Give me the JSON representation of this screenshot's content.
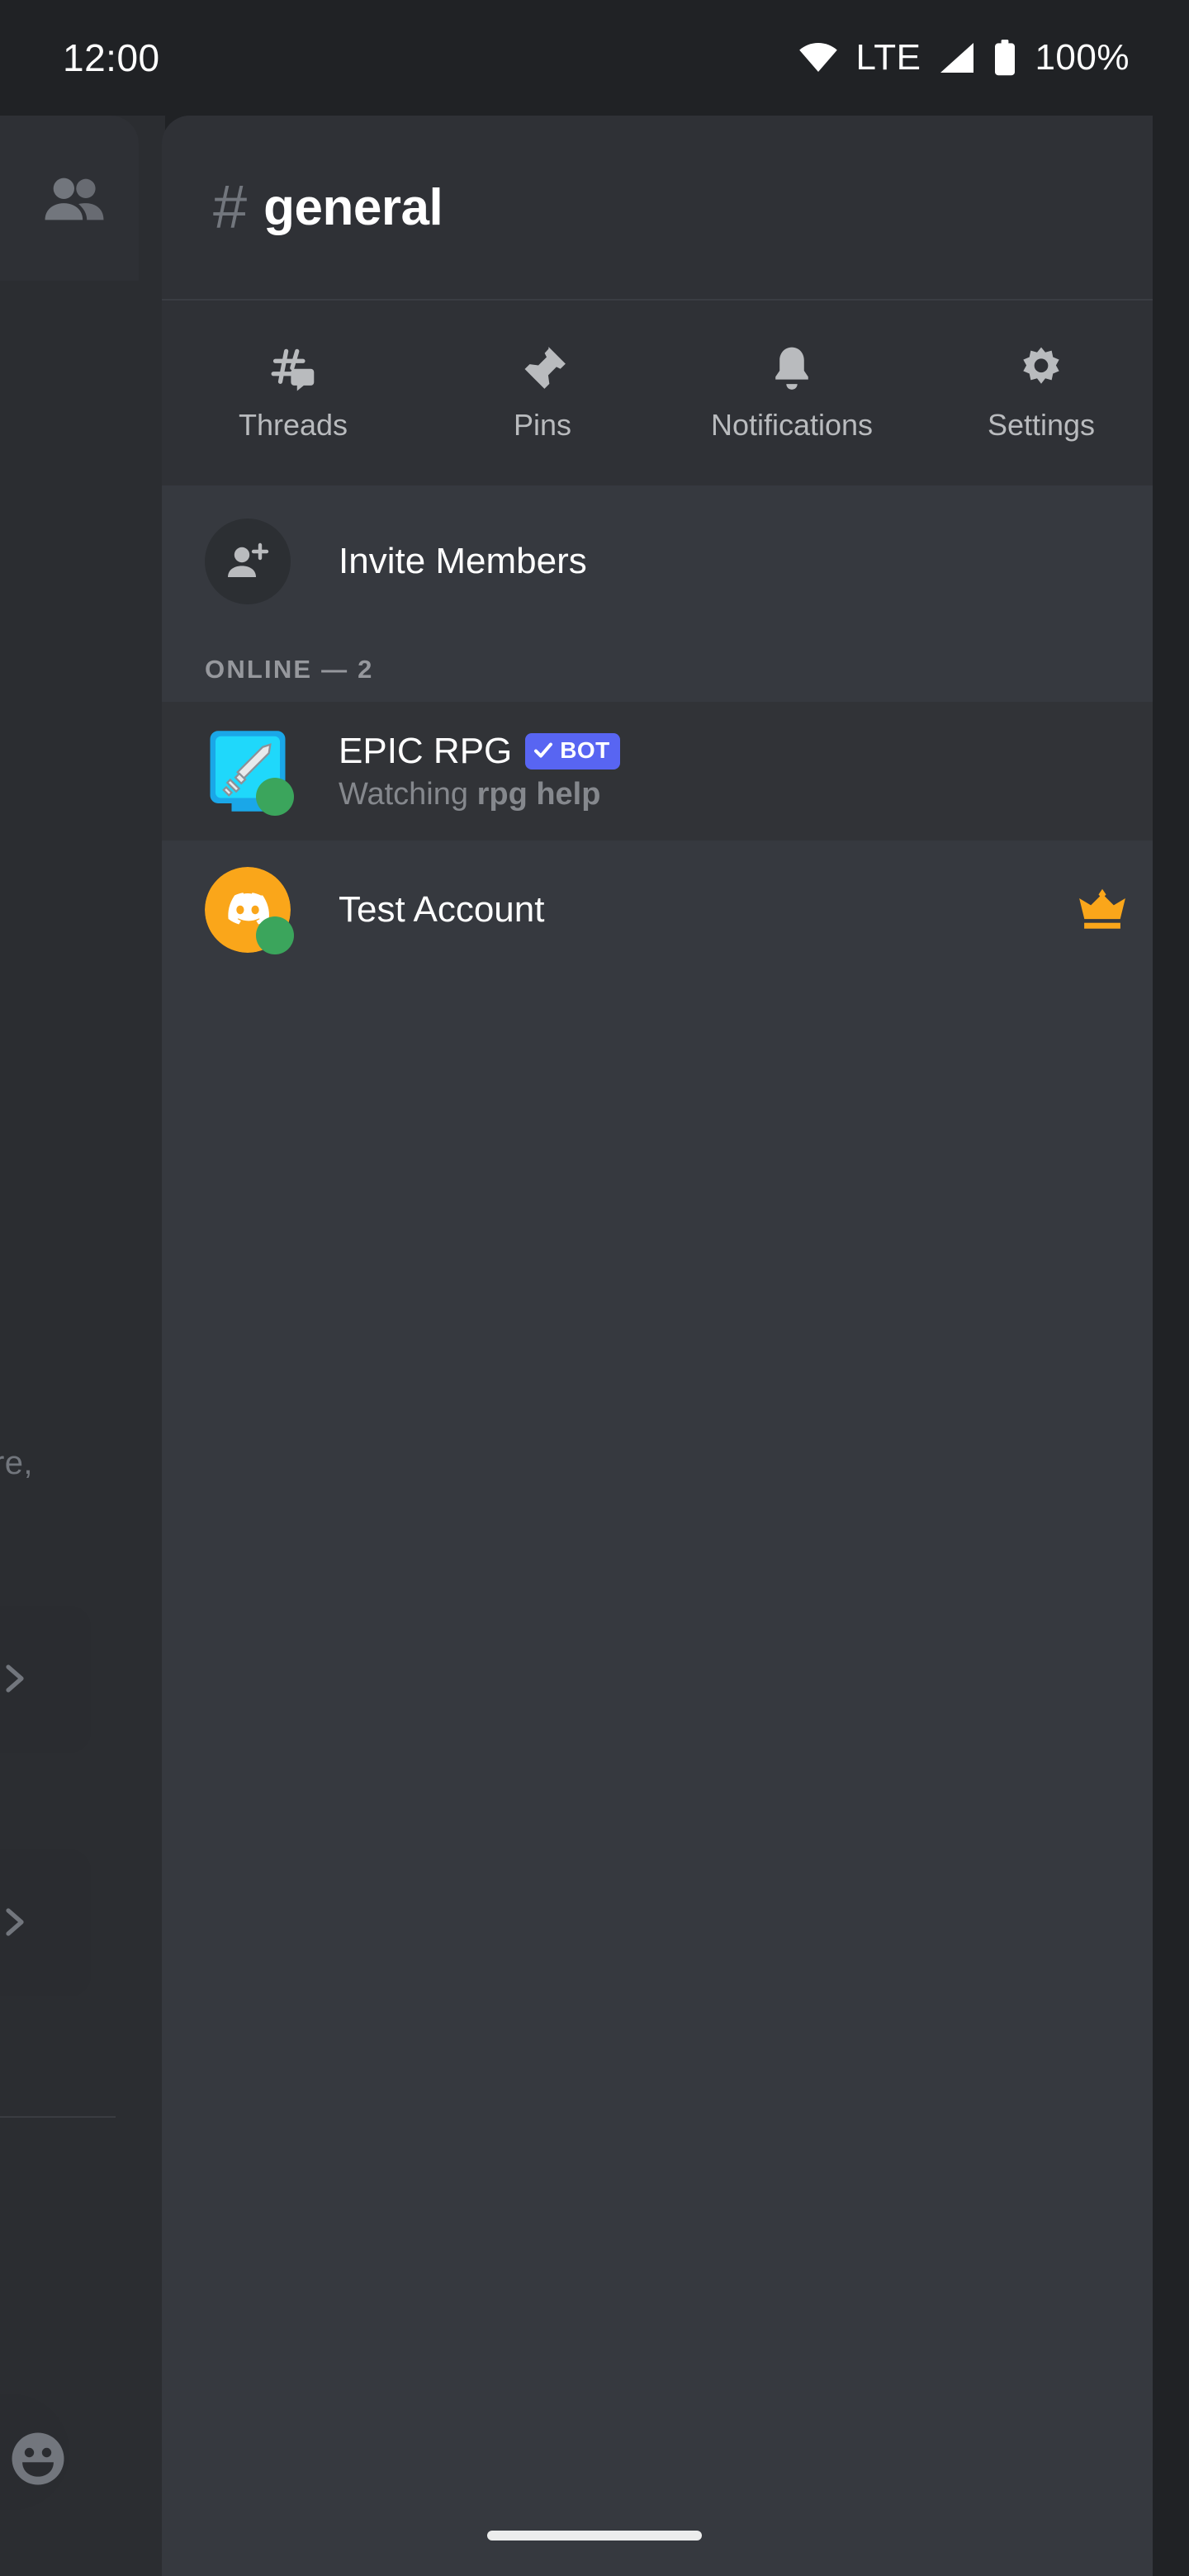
{
  "status_bar": {
    "time": "12:00",
    "network_label": "LTE",
    "battery_label": "100%",
    "icons": [
      "wifi-icon",
      "cellular-signal-icon",
      "battery-icon"
    ]
  },
  "background_view": {
    "members_icon": "members-icon",
    "text_fragment": "re,",
    "chevron_icon": "chevron-right-icon",
    "emoji_icon": "emoji-smiley-icon"
  },
  "channel_header": {
    "hash": "#",
    "name": "general"
  },
  "actions": [
    {
      "label": "Threads",
      "icon": "threads-icon"
    },
    {
      "label": "Pins",
      "icon": "pin-icon"
    },
    {
      "label": "Notifications",
      "icon": "bell-icon"
    },
    {
      "label": "Settings",
      "icon": "gear-icon"
    }
  ],
  "invite": {
    "label": "Invite Members",
    "icon": "person-add-icon"
  },
  "member_list": {
    "group_label": "ONLINE — 2",
    "members": [
      {
        "name": "EPIC RPG",
        "badge": "BOT",
        "badge_check": "check-icon",
        "status_prefix": "Watching ",
        "status_activity": "rpg help",
        "presence": "online",
        "avatar": "epic-rpg-sword-avatar",
        "owner": false,
        "pressed": true
      },
      {
        "name": "Test Account",
        "badge": null,
        "status_prefix": "",
        "status_activity": "",
        "presence": "online",
        "avatar": "discord-clyde-avatar",
        "owner": true,
        "owner_icon": "crown-icon",
        "pressed": false
      }
    ]
  },
  "nav_bar": {
    "gesture_pill": "home-gesture-pill"
  },
  "colors": {
    "status_bar_bg": "#202225",
    "panel_bg": "#2f3136",
    "list_bg": "#36393f",
    "accent_blurple": "#5865f2",
    "online_green": "#3ba55c",
    "owner_gold": "#faa61a",
    "text_primary": "#ffffff",
    "text_muted": "#b9bbbe"
  }
}
